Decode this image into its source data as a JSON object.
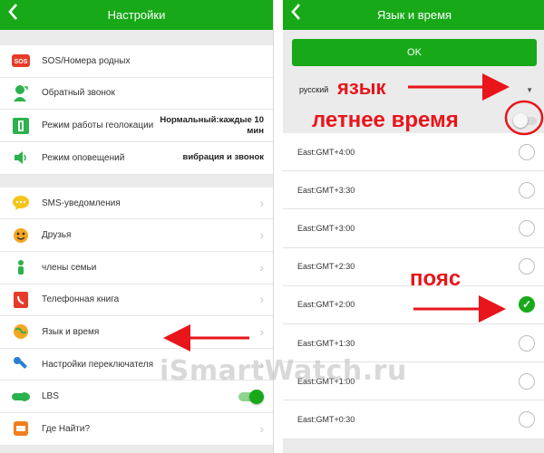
{
  "left": {
    "title": "Настройки",
    "group1": [
      {
        "label": "SOS/Номера родных",
        "icon": "sos-icon"
      },
      {
        "label": "Обратный звонок",
        "icon": "callback-person-icon"
      },
      {
        "label": "Режим работы геолокации",
        "icon": "geolocation-mode-icon",
        "value": "Нормальный:каждые 10 мин"
      },
      {
        "label": "Режим оповещений",
        "icon": "speaker-icon",
        "value": "вибрация и звонок"
      }
    ],
    "group2": [
      {
        "label": "SMS-уведомления",
        "icon": "chat-bubble-icon"
      },
      {
        "label": "Друзья",
        "icon": "friends-emoji-icon"
      },
      {
        "label": "члены семьи",
        "icon": "family-figure-icon"
      },
      {
        "label": "Телефонная книга",
        "icon": "phonebook-icon"
      },
      {
        "label": "Язык и время",
        "icon": "globe-clock-icon"
      },
      {
        "label": "Настройки переключателя",
        "icon": "wrench-icon"
      },
      {
        "label": "LBS",
        "icon": "lbs-toggle-icon",
        "toggle_on": true
      },
      {
        "label": "Где Найти?",
        "icon": "find-watch-icon"
      }
    ]
  },
  "right": {
    "title": "Язык и время",
    "ok_label": "OK",
    "language_value": "русский",
    "dst_on": false,
    "timezones": [
      {
        "label": "East:GMT+4:00",
        "selected": false
      },
      {
        "label": "East:GMT+3:30",
        "selected": false
      },
      {
        "label": "East:GMT+3:00",
        "selected": false
      },
      {
        "label": "East:GMT+2:30",
        "selected": false
      },
      {
        "label": "East:GMT+2:00",
        "selected": true
      },
      {
        "label": "East:GMT+1:30",
        "selected": false
      },
      {
        "label": "East:GMT+1:00",
        "selected": false
      },
      {
        "label": "East:GMT+0:30",
        "selected": false
      }
    ]
  },
  "annotations": {
    "language": "язык",
    "dst": "летнее время",
    "timezone": "пояс"
  },
  "watermark": "iSmartWatch.ru",
  "colors": {
    "brand_green": "#18a918",
    "annotation_red": "#e8151b"
  }
}
